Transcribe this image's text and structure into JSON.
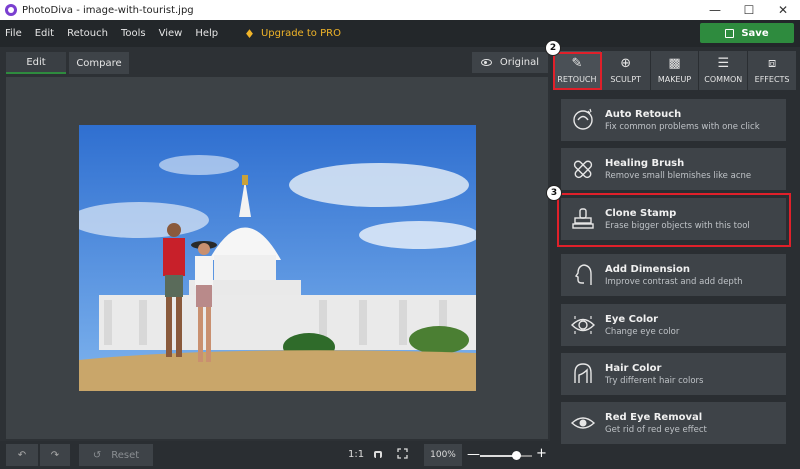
{
  "window": {
    "title": "PhotoDiva - image-with-tourist.jpg"
  },
  "menu": {
    "items": [
      "File",
      "Edit",
      "Retouch",
      "Tools",
      "View",
      "Help"
    ],
    "upgrade": "Upgrade to PRO"
  },
  "toolbar": {
    "save_label": "Save"
  },
  "view_tabs": {
    "edit": "Edit",
    "compare": "Compare",
    "original": "Original"
  },
  "categories": [
    {
      "label": "RETOUCH",
      "icon": "brush-icon"
    },
    {
      "label": "SCULPT",
      "icon": "globe-icon"
    },
    {
      "label": "MAKEUP",
      "icon": "makeup-icon"
    },
    {
      "label": "COMMON",
      "icon": "sliders-icon"
    },
    {
      "label": "EFFECTS",
      "icon": "effects-icon"
    }
  ],
  "tools": [
    {
      "title": "Auto Retouch",
      "desc": "Fix common problems with one click",
      "icon": "auto-retouch-icon"
    },
    {
      "title": "Healing Brush",
      "desc": "Remove small blemishes like acne",
      "icon": "bandage-icon"
    },
    {
      "title": "Clone Stamp",
      "desc": "Erase bigger objects with this tool",
      "icon": "stamp-icon"
    },
    {
      "title": "Add Dimension",
      "desc": "Improve contrast and add depth",
      "icon": "face-profile-icon"
    },
    {
      "title": "Eye Color",
      "desc": "Change eye color",
      "icon": "eye-icon"
    },
    {
      "title": "Hair Color",
      "desc": "Try different hair colors",
      "icon": "hair-icon"
    },
    {
      "title": "Red Eye Removal",
      "desc": "Get rid of red eye effect",
      "icon": "red-eye-icon"
    }
  ],
  "annotations": {
    "step2": "2",
    "step3": "3"
  },
  "bottom": {
    "reset": "Reset",
    "ratio": "1:1",
    "zoom": "100%",
    "zoom_level": 0.7
  },
  "colors": {
    "accent": "#2e8b3e",
    "upgrade": "#f0b429",
    "callout": "#e0202a"
  }
}
